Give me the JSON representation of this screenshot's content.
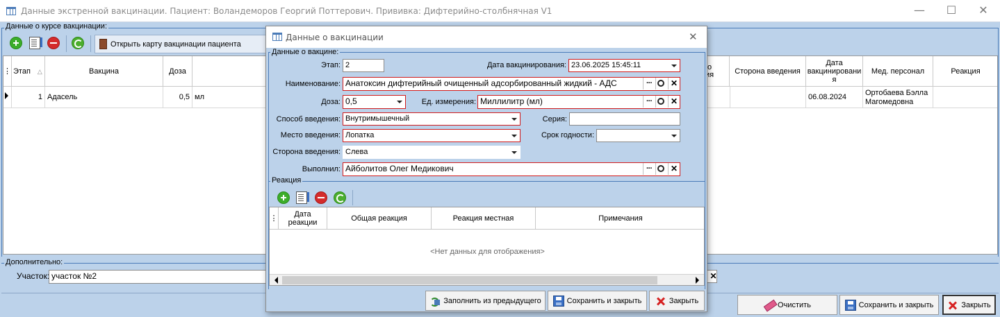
{
  "main_window": {
    "title": "Данные экстренной вакцинации. Пациент: Воландеморов Георгий Поттерович. Прививка: Дифтерийно-столбнячная V1",
    "course_group_label": "Данные о курсе вакцинации:",
    "open_card_button": "Открыть карту вакцинации пациента",
    "grid": {
      "columns": [
        "Этап",
        "Вакцина",
        "Доза",
        "Сторона введения",
        "Дата вакцинировани я",
        "Мед. персонал",
        "Реакция"
      ],
      "hidden_column_fragment": "о\nия",
      "rows": [
        {
          "stage": "1",
          "vaccine": "Адасель",
          "dose": "0,5",
          "unit": "мл",
          "side": "",
          "date": "06.08.2024",
          "staff": "Ортобаева Бэлла Магомедовна",
          "reaction": ""
        }
      ]
    },
    "additional_label": "Дополнительно:",
    "district_label": "Участок:",
    "district_value": "участок №2",
    "clear_button": "Очистить",
    "save_close_button": "Сохранить и закрыть",
    "close_button": "Закрыть"
  },
  "dialog": {
    "title": "Данные о вакцинации",
    "vaccine_group_label": "Данные о вакцине:",
    "stage_label": "Этап:",
    "stage_value": "2",
    "vacc_date_label": "Дата вакцинирования:",
    "vacc_date_value": "23.06.2025 15:45:11",
    "name_label": "Наименование:",
    "name_value": "Анатоксин дифтерийный очищенный адсорбированный жидкий - АДС",
    "dose_label": "Доза:",
    "dose_value": "0,5",
    "unit_label": "Ед. измерения:",
    "unit_value": "Миллилитр (мл)",
    "route_label": "Способ введения:",
    "route_value": "Внутримышечный",
    "series_label": "Серия:",
    "series_value": "",
    "site_label": "Место введения:",
    "site_value": "Лопатка",
    "expiry_label": "Срок годности:",
    "expiry_value": "",
    "side_label": "Сторона введения:",
    "side_value": "Слева",
    "performer_label": "Выполнил:",
    "performer_value": "Айболитов Олег Медикович",
    "reaction_group_label": "Реакция",
    "reaction_columns": [
      "Дата реакции",
      "Общая реакция",
      "Реакция местная",
      "Примечания"
    ],
    "empty_text": "<Нет данных для отображения>",
    "fill_prev_button": "Заполнить из предыдущего",
    "save_close_button": "Сохранить и закрыть",
    "close_button": "Закрыть"
  }
}
